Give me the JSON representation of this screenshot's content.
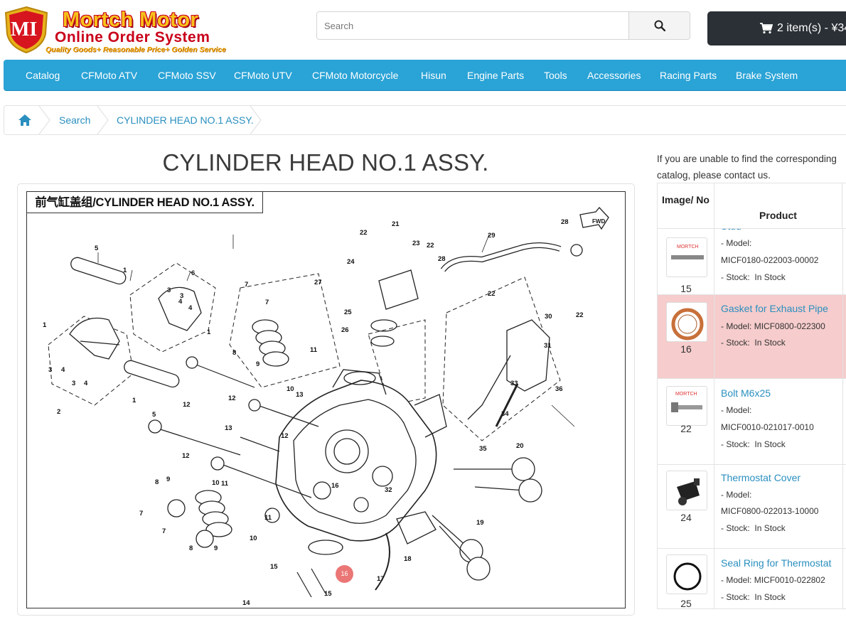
{
  "header": {
    "logo_initials": "MI",
    "logo_title": "Mortch Motor",
    "logo_subtitle": "Online Order System",
    "logo_tagline": "Quality Goods+ Reasonable Price+ Golden Service",
    "search_placeholder": "Search",
    "cart_label": "2 item(s) - ¥34"
  },
  "nav": {
    "items": [
      "Catalog",
      "CFMoto ATV",
      "CFMoto SSV",
      "CFMoto UTV",
      "CFMoto Motorcycle",
      "Hisun",
      "Engine Parts",
      "Tools",
      "Accessories",
      "Racing Parts",
      "Brake System"
    ]
  },
  "breadcrumb": {
    "items": [
      "Search",
      "CYLINDER HEAD NO.1 ASSY."
    ]
  },
  "main": {
    "page_title": "CYLINDER HEAD NO.1 ASSY.",
    "diagram_label": "前气缸盖组/CYLINDER HEAD NO.1 ASSY.",
    "selected_hotspot": "16"
  },
  "sidebar": {
    "help_text": "If you are unable to find the corresponding catalog, please contact us.",
    "table_headers": {
      "image_no": "Image/ No",
      "product": "Product"
    },
    "rows": [
      {
        "no": "15",
        "name": "Stud",
        "model_label": "- Model:",
        "model": "MICF0180-022003-00002",
        "stock_label": "- Stock:",
        "stock": "In Stock",
        "highlight": false
      },
      {
        "no": "16",
        "name": "Gasket for Exhaust Pipe",
        "model_label": "- Model:",
        "model": "MICF0800-022300",
        "stock_label": "- Stock:",
        "stock": "In Stock",
        "highlight": true
      },
      {
        "no": "22",
        "name": "Bolt M6x25",
        "model_label": "- Model:",
        "model": "MICF0010-021017-0010",
        "stock_label": "- Stock:",
        "stock": "In Stock",
        "highlight": false
      },
      {
        "no": "24",
        "name": "Thermostat Cover",
        "model_label": "- Model:",
        "model": "MICF0800-022013-10000",
        "stock_label": "- Stock:",
        "stock": "In Stock",
        "highlight": false
      },
      {
        "no": "25",
        "name": "Seal Ring for Thermostat",
        "model_label": "- Model:",
        "model": "MICF0010-022802",
        "stock_label": "- Stock:",
        "stock": "In Stock",
        "highlight": false
      }
    ]
  },
  "colors": {
    "nav_bg": "#2aa3d6",
    "link": "#2a8fbf",
    "cart_bg": "#2b3036",
    "highlight_row": "#f6cccc",
    "hotspot": "#e65050"
  }
}
